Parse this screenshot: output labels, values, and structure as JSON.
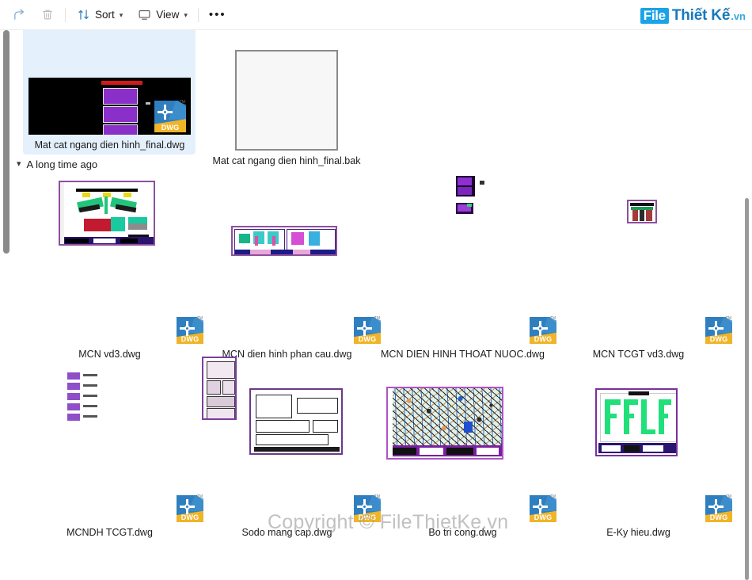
{
  "toolbar": {
    "buttons": [
      {
        "name": "share-button",
        "icon": "share-icon",
        "label": ""
      },
      {
        "name": "delete-button",
        "icon": "trash-icon",
        "label": ""
      },
      {
        "name": "sort-button",
        "icon": "sort-icon",
        "label": "Sort",
        "chevron": "⌄"
      },
      {
        "name": "view-button",
        "icon": "view-icon",
        "label": "View",
        "chevron": "⌄"
      },
      {
        "name": "more-button",
        "icon": "ellipsis-icon",
        "label": "•••"
      }
    ],
    "sort_label": "Sort",
    "view_label": "View",
    "more_label": "•••"
  },
  "brand": {
    "box": "File",
    "text": "Thiết Kế",
    "tld": ".vn",
    "box_color": "#1aa3e8",
    "text_color": "#1679bd"
  },
  "watermark": "Copyright © FileThietKe.vn",
  "group_header": {
    "chevron": "⌄",
    "label": "A long time ago"
  },
  "selection_color": "#e4f0fb",
  "rows": [
    {
      "name": "row-top",
      "items": [
        {
          "label": "Mat cat ngang dien hinh_final.dwg",
          "selected": true,
          "kind": "dwg-dark",
          "badge": "DWG"
        },
        {
          "label": "Mat cat ngang dien hinh_final.bak",
          "selected": false,
          "kind": "blank",
          "badge": ""
        }
      ]
    },
    {
      "name": "row-2",
      "items": [
        {
          "label": "",
          "selected": false,
          "kind": "plan-green",
          "badge": ""
        },
        {
          "label": "",
          "selected": false,
          "kind": "twin-panel",
          "badge": ""
        },
        {
          "label": "",
          "selected": false,
          "kind": "tiny-purple",
          "badge": ""
        },
        {
          "label": "",
          "selected": false,
          "kind": "small-frame",
          "badge": ""
        }
      ]
    },
    {
      "name": "row-3",
      "items": [
        {
          "label": "MCN vd3.dwg",
          "selected": false,
          "kind": "dwg-only",
          "badge": "DWG"
        },
        {
          "label": "MCN dien hinh phan cau.dwg",
          "selected": false,
          "kind": "dwg-only",
          "badge": "DWG"
        },
        {
          "label": "MCN DIEN HINH THOAT NUOC.dwg",
          "selected": false,
          "kind": "dwg-only",
          "badge": "DWG"
        },
        {
          "label": "MCN TCGT vd3.dwg",
          "selected": false,
          "kind": "dwg-only",
          "badge": "DWG"
        }
      ]
    },
    {
      "name": "row-4",
      "items": [
        {
          "label": "",
          "selected": false,
          "kind": "mini-rows",
          "badge": ""
        },
        {
          "label": "",
          "selected": false,
          "kind": "two-sheets",
          "badge": ""
        },
        {
          "label": "",
          "selected": false,
          "kind": "dense-map",
          "badge": ""
        },
        {
          "label": "",
          "selected": false,
          "kind": "green-file",
          "badge": ""
        }
      ]
    },
    {
      "name": "row-5",
      "items": [
        {
          "label": "MCNDH TCGT.dwg",
          "selected": false,
          "kind": "dwg-only",
          "badge": "DWG"
        },
        {
          "label": "Sodo mang cap.dwg",
          "selected": false,
          "kind": "dwg-only",
          "badge": "DWG",
          "obscured": true
        },
        {
          "label": "Bo tri cong.dwg",
          "selected": false,
          "kind": "dwg-only",
          "badge": "DWG",
          "obscured": true
        },
        {
          "label": "E-Ky hieu.dwg",
          "selected": false,
          "kind": "dwg-only",
          "badge": "DWG"
        }
      ]
    }
  ]
}
